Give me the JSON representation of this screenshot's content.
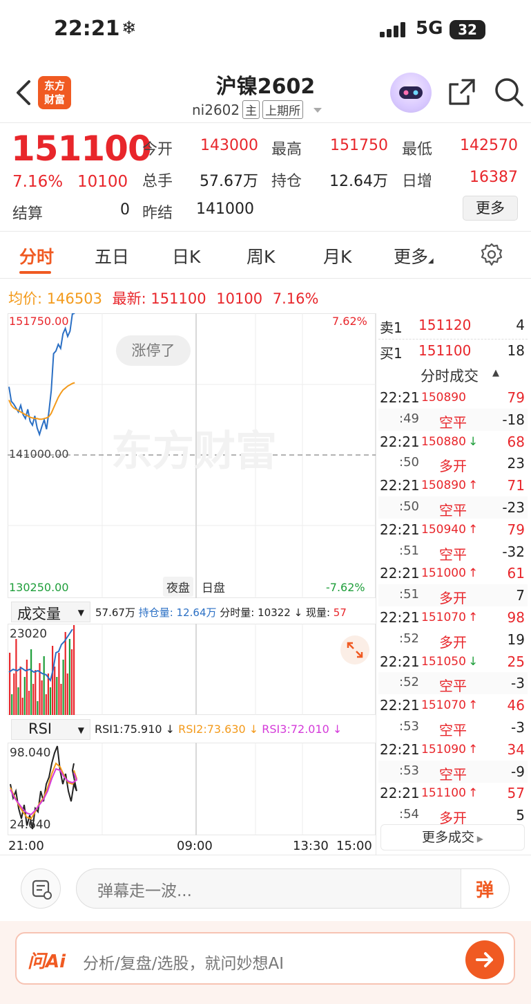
{
  "status_bar": {
    "time": "22:21",
    "snow": "❄",
    "network": "5G",
    "battery": "32"
  },
  "header": {
    "logo_text": "东方\n财富",
    "title": "沪镍2602",
    "code": "ni2602",
    "tag_main": "主",
    "tag_exchange": "上期所"
  },
  "quote": {
    "price": "151100",
    "change_pct": "7.16%",
    "change": "10100",
    "settle_label": "结算",
    "settle": "0",
    "open_label": "今开",
    "open": "143000",
    "high_label": "最高",
    "high": "151750",
    "low_label": "最低",
    "low": "142570",
    "volume_label": "总手",
    "volume": "57.67万",
    "oi_label": "持仓",
    "oi": "12.64万",
    "daily_inc_label": "日增",
    "daily_inc": "16387",
    "prev_close_label": "昨结",
    "prev_close": "141000",
    "more": "更多"
  },
  "tabs": [
    "分时",
    "五日",
    "日K",
    "周K",
    "月K",
    "更多"
  ],
  "info_line": {
    "avg_label": "均价:",
    "avg": "146503",
    "latest_label": "最新:",
    "latest": "151100",
    "change": "10100",
    "pct": "7.16%"
  },
  "chart": {
    "y_top": "151750.00",
    "y_mid": "141000.00",
    "y_bottom": "130250.00",
    "pct_top": "7.62%",
    "pct_bottom": "-7.62%",
    "limit_badge": "涨停了",
    "watermark": "东方财富",
    "night": "夜盘",
    "day": "日盘",
    "vol_select": "成交量",
    "vol_total": "57.67万",
    "vol_oi": "持仓量: 12.64万",
    "vol_tick": "分时量: 10322 ↓",
    "vol_now_label": "现量:",
    "vol_now": "57",
    "vol_max": "23020",
    "rsi_select": "RSI",
    "rsi1": "RSI1:75.910 ↓",
    "rsi2": "RSI2:73.630 ↓",
    "rsi3": "RSI3:72.010 ↓",
    "rsi_top": "98.040",
    "rsi_bottom": "24.640",
    "x_labels": [
      "21:00",
      "09:00",
      "13:30",
      "15:00"
    ]
  },
  "chart_data": {
    "type": "line",
    "title": "",
    "ylim": [
      130250,
      151750
    ],
    "series": [
      {
        "name": "",
        "values": [
          146200,
          145100,
          144900,
          144600,
          144300,
          144800,
          144100,
          143800,
          144500,
          143600,
          143300,
          144000,
          143100,
          142600,
          143200,
          143700,
          143000,
          144300,
          145900,
          148700,
          148900,
          149400,
          149100,
          150200,
          150600,
          150000,
          150400,
          151700,
          151750
        ]
      },
      {
        "name": "",
        "values": [
          145200,
          144800,
          144600,
          144500,
          144400,
          144300,
          144200,
          144100,
          144000,
          143900,
          143850,
          143800,
          143800,
          143750,
          143750,
          143800,
          143850,
          143950,
          144200,
          144600,
          145000,
          145400,
          145700,
          145950,
          146100,
          146250,
          146350,
          146450,
          146503
        ]
      }
    ]
  },
  "order_book": [
    {
      "label": "卖1",
      "price": "151120",
      "qty": "4"
    },
    {
      "label": "买1",
      "price": "151100",
      "qty": "18"
    }
  ],
  "trades_title": "分时成交",
  "trades": [
    {
      "time": "22:21",
      "price": "150890",
      "arrow": "",
      "qty": "79",
      "sec": ":49",
      "type": "空平",
      "oi": "-18"
    },
    {
      "time": "22:21",
      "price": "150880",
      "arrow": "↓",
      "qty": "68",
      "sec": ":50",
      "type": "多开",
      "oi": "23"
    },
    {
      "time": "22:21",
      "price": "150890",
      "arrow": "↑",
      "qty": "71",
      "sec": ":50",
      "type": "空平",
      "oi": "-23"
    },
    {
      "time": "22:21",
      "price": "150940",
      "arrow": "↑",
      "qty": "79",
      "sec": ":51",
      "type": "空平",
      "oi": "-32"
    },
    {
      "time": "22:21",
      "price": "151000",
      "arrow": "↑",
      "qty": "61",
      "sec": ":51",
      "type": "多开",
      "oi": "7"
    },
    {
      "time": "22:21",
      "price": "151070",
      "arrow": "↑",
      "qty": "98",
      "sec": ":52",
      "type": "多开",
      "oi": "19"
    },
    {
      "time": "22:21",
      "price": "151050",
      "arrow": "↓",
      "qty": "25",
      "sec": ":52",
      "type": "空平",
      "oi": "-3"
    },
    {
      "time": "22:21",
      "price": "151070",
      "arrow": "↑",
      "qty": "46",
      "sec": ":53",
      "type": "空平",
      "oi": "-3"
    },
    {
      "time": "22:21",
      "price": "151090",
      "arrow": "↑",
      "qty": "34",
      "sec": ":53",
      "type": "空平",
      "oi": "-9"
    },
    {
      "time": "22:21",
      "price": "151100",
      "arrow": "↑",
      "qty": "57",
      "sec": ":54",
      "type": "多开",
      "oi": "5"
    }
  ],
  "more_trades": "更多成交",
  "bottom": {
    "danmu_placeholder": "弹幕走一波...",
    "danmu_btn": "弹",
    "ai_logo": "问Ai",
    "ai_placeholder": "分析/复盘/选股，就问妙想AI"
  }
}
